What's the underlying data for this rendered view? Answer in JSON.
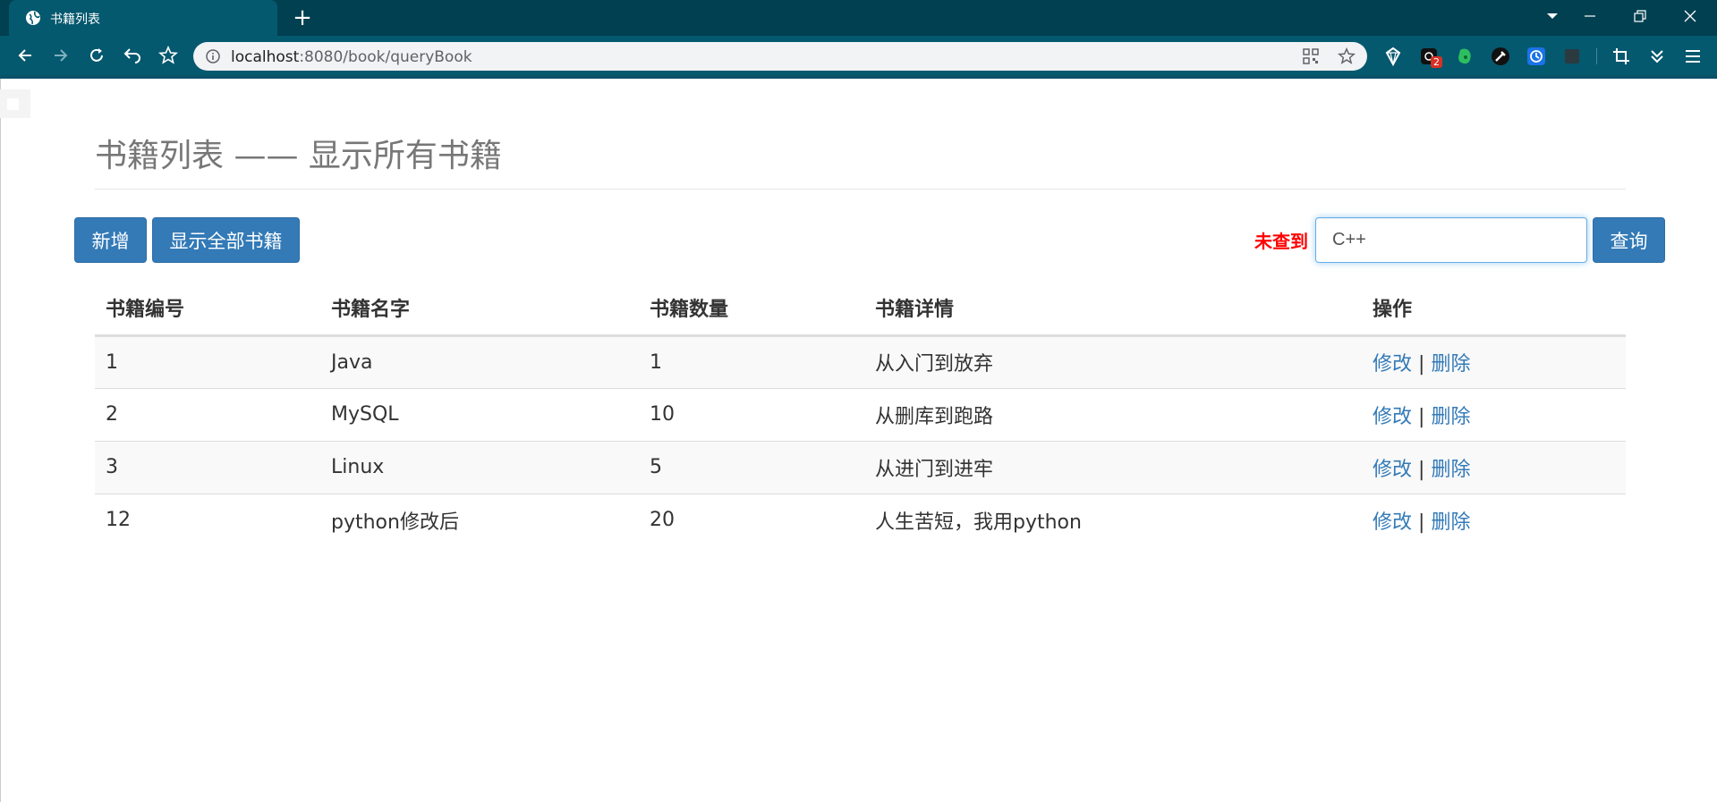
{
  "browser": {
    "tab_title": "书籍列表",
    "new_tab_label": "+",
    "url_host": "localhost",
    "url_rest": ":8080/book/queryBook",
    "extension_badge": "2"
  },
  "page": {
    "title": "书籍列表 —— 显示所有书籍",
    "add_button": "新增",
    "show_all_button": "显示全部书籍",
    "error_message": "未查到",
    "search_value": "C++",
    "query_button": "查询"
  },
  "table": {
    "headers": [
      "书籍编号",
      "书籍名字",
      "书籍数量",
      "书籍详情",
      "操作"
    ],
    "rows": [
      {
        "id": "1",
        "name": "Java",
        "count": "1",
        "detail": "从入门到放弃"
      },
      {
        "id": "2",
        "name": "MySQL",
        "count": "10",
        "detail": "从删库到跑路"
      },
      {
        "id": "3",
        "name": "Linux",
        "count": "5",
        "detail": "从进门到进牢"
      },
      {
        "id": "12",
        "name": "python修改后",
        "count": "20",
        "detail": "人生苦短，我用python"
      }
    ],
    "edit_label": "修改",
    "separator": "|",
    "delete_label": "删除"
  },
  "colors": {
    "primary": "#337ab7",
    "error": "#ff0000",
    "chrome_dark": "#014051",
    "chrome_toolbar": "#04596f"
  }
}
